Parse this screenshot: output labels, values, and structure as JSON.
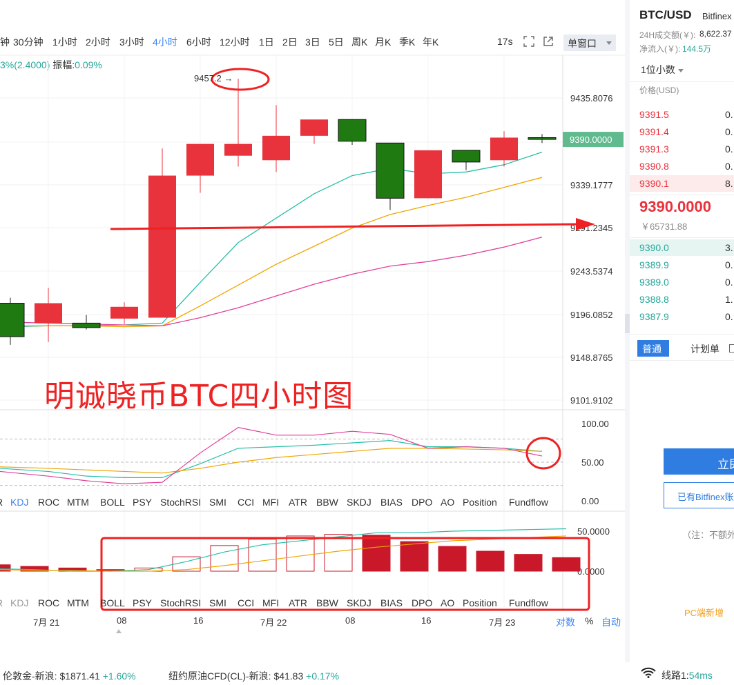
{
  "toolbar": {
    "timeframes": [
      "钟",
      "30分钟",
      "1小时",
      "2小时",
      "3小时",
      "4小时",
      "6小时",
      "12小时",
      "1日",
      "2日",
      "3日",
      "5日",
      "周K",
      "月K",
      "季K",
      "年K"
    ],
    "active_timeframe": "4小时",
    "refresh_timer": "17s",
    "window_mode": "单窗口"
  },
  "info_line": {
    "change_prefix": "3%(2.4000)",
    "amplitude_label": "振幅:",
    "amplitude_value": "0.09%"
  },
  "chart": {
    "peak_label": "9457.2 →",
    "annotation": "明诚晓币BTC四小时图",
    "current_price_tag": "9390.0000",
    "price_axis": [
      "9435.8076",
      "9339.1777",
      "9291.2345",
      "9243.5374",
      "9196.0852",
      "9148.8765",
      "9101.9102"
    ],
    "osc_axis": [
      "100.00",
      "50.00",
      "0.00"
    ],
    "macd_axis": [
      "50.0000",
      "0.0000"
    ],
    "indicator_tabs_1": [
      "R",
      "KDJ",
      "ROC",
      "MTM",
      "BOLL",
      "PSY",
      "StochRSI",
      "SMI",
      "CCI",
      "MFI",
      "ATR",
      "BBW",
      "SKDJ",
      "BIAS",
      "DPO",
      "AO",
      "Position",
      "Fundflow"
    ],
    "indicator_tabs_2": [
      "R",
      "KDJ",
      "ROC",
      "MTM",
      "BOLL",
      "PSY",
      "StochRSI",
      "SMI",
      "CCI",
      "MFI",
      "ATR",
      "BBW",
      "SKDJ",
      "BIAS",
      "DPO",
      "AO",
      "Position",
      "Fundflow"
    ],
    "active_indicator": "KDJ",
    "x_labels": [
      "7月 21",
      "08",
      "16",
      "7月 22",
      "08",
      "16",
      "7月 23"
    ],
    "axis_modes": {
      "log": "对数",
      "pct": "%",
      "auto": "自动"
    }
  },
  "chart_data": {
    "type": "candlestick",
    "interval": "4小时",
    "candles": [
      {
        "o": 9209,
        "h": 9215,
        "l": 9163,
        "c": 9172
      },
      {
        "o": 9187,
        "h": 9226,
        "l": 9166,
        "c": 9209
      },
      {
        "o": 9187,
        "h": 9196,
        "l": 9180,
        "c": 9182
      },
      {
        "o": 9192,
        "h": 9210,
        "l": 9186,
        "c": 9205
      },
      {
        "o": 9193,
        "h": 9380,
        "l": 9193,
        "c": 9350
      },
      {
        "o": 9350,
        "h": 9381,
        "l": 9331,
        "c": 9385
      },
      {
        "o": 9372,
        "h": 9457.2,
        "l": 9360,
        "c": 9385
      },
      {
        "o": 9367,
        "h": 9428,
        "l": 9354,
        "c": 9394
      },
      {
        "o": 9394,
        "h": 9410,
        "l": 9385,
        "c": 9412
      },
      {
        "o": 9412,
        "h": 9412,
        "l": 9384,
        "c": 9388
      },
      {
        "o": 9386,
        "h": 9386,
        "l": 9312,
        "c": 9325
      },
      {
        "o": 9325,
        "h": 9378,
        "l": 9325,
        "c": 9378
      },
      {
        "o": 9378,
        "h": 9378,
        "l": 9356,
        "c": 9365
      },
      {
        "o": 9367,
        "h": 9399,
        "l": 9360,
        "c": 9392
      },
      {
        "o": 9392,
        "h": 9396,
        "l": 9386,
        "c": 9390
      }
    ],
    "ma_series": [
      {
        "color": "#26bfa8",
        "values": [
          9183,
          9184,
          9184,
          9185,
          9187,
          9232,
          9276,
          9303,
          9330,
          9350,
          9358,
          9352,
          9354,
          9362,
          9376
        ]
      },
      {
        "color": "#f0a500",
        "values": [
          9184,
          9184,
          9184,
          9183,
          9184,
          9206,
          9229,
          9252,
          9272,
          9292,
          9307,
          9317,
          9326,
          9337,
          9348
        ]
      },
      {
        "color": "#e0409a",
        "values": [
          9188,
          9187,
          9186,
          9185,
          9184,
          9193,
          9204,
          9217,
          9230,
          9241,
          9250,
          9255,
          9262,
          9271,
          9282
        ]
      }
    ],
    "oscillator": {
      "range": [
        0,
        100
      ],
      "series": [
        {
          "color": "#26bfa8",
          "values": [
            42,
            38,
            32,
            30,
            30,
            48,
            68,
            70,
            72,
            75,
            78,
            70,
            70,
            68,
            64
          ]
        },
        {
          "color": "#f0a500",
          "values": [
            44,
            42,
            40,
            38,
            36,
            42,
            50,
            56,
            60,
            64,
            68,
            68,
            67,
            66,
            64
          ]
        },
        {
          "color": "#e0409a",
          "values": [
            38,
            32,
            26,
            22,
            24,
            62,
            95,
            85,
            85,
            90,
            86,
            68,
            70,
            68,
            58
          ]
        }
      ]
    },
    "macd": {
      "range": [
        -30,
        60
      ],
      "bars": [
        8,
        6,
        4,
        2,
        4,
        18,
        32,
        40,
        44,
        46,
        45,
        37,
        31,
        25,
        21,
        17
      ],
      "dif": [
        3,
        2,
        0,
        0,
        2,
        12,
        24,
        33,
        38,
        43,
        48,
        48,
        50,
        51,
        52,
        53
      ],
      "dea": [
        2,
        1,
        1,
        0,
        0,
        2,
        7,
        13,
        19,
        25,
        30,
        34,
        38,
        40,
        42,
        44
      ]
    }
  },
  "right_panel": {
    "pair": "BTC/USD",
    "exchange": "Bitfinex",
    "volume_label": "24H成交额(￥):",
    "volume_value": "8,622.37",
    "inflow_label": "净流入(￥):",
    "inflow_value": "144.5万",
    "decimals": "1位小数",
    "price_head": "价格(USD)",
    "asks": [
      {
        "price": "9391.5",
        "qty": "0."
      },
      {
        "price": "9391.4",
        "qty": "0."
      },
      {
        "price": "9391.3",
        "qty": "0."
      },
      {
        "price": "9390.8",
        "qty": "0."
      },
      {
        "price": "9390.1",
        "qty": "8."
      }
    ],
    "last_price": "9390.0000",
    "last_cny": "￥65731.88",
    "bids": [
      {
        "price": "9390.0",
        "qty": "3."
      },
      {
        "price": "9389.9",
        "qty": "0."
      },
      {
        "price": "9389.0",
        "qty": "0."
      },
      {
        "price": "9388.8",
        "qty": "1."
      },
      {
        "price": "9387.9",
        "qty": "0."
      }
    ],
    "tab_normal": "普通",
    "tab_plan": "计划单",
    "btn_primary": "立即",
    "btn_secondary": "已有Bitfinex账",
    "note": "（注：不额外",
    "promo": "PC端新增"
  },
  "ticker": {
    "gold_label": "伦敦金-新浪:",
    "gold_price": "$1871.41",
    "gold_change": "+1.60%",
    "oil_label": "纽约原油CFD(CL)-新浪:",
    "oil_price": "$41.83",
    "oil_change": "+0.17%",
    "line_label": "线路1:",
    "line_latency": "54ms"
  },
  "colors": {
    "up": "#e8323c",
    "down": "#1f7a12",
    "accent": "#3b82f6",
    "price_tag": "#5fba8d",
    "annotation": "#ee2222"
  }
}
